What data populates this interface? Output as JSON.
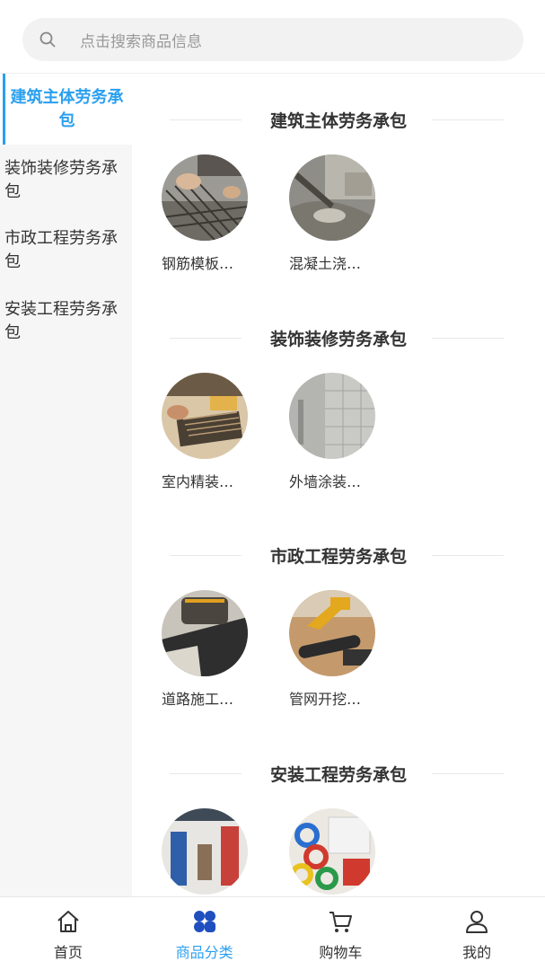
{
  "search": {
    "placeholder": "点击搜索商品信息",
    "icon": "search-icon"
  },
  "sidebar": {
    "items": [
      {
        "label": "建筑主体劳务承包",
        "active": true
      },
      {
        "label": "装饰装修劳务承包",
        "active": false
      },
      {
        "label": "市政工程劳务承包",
        "active": false
      },
      {
        "label": "安装工程劳务承包",
        "active": false
      }
    ]
  },
  "categories": [
    {
      "title": "建筑主体劳务承包",
      "items": [
        {
          "name": "钢筋模板…"
        },
        {
          "name": "混凝土浇…"
        }
      ]
    },
    {
      "title": "装饰装修劳务承包",
      "items": [
        {
          "name": "室内精装…"
        },
        {
          "name": "外墙涂装…"
        }
      ]
    },
    {
      "title": "市政工程劳务承包",
      "items": [
        {
          "name": "道路施工…"
        },
        {
          "name": "管网开挖…"
        }
      ]
    },
    {
      "title": "安装工程劳务承包",
      "items": [
        {
          "name": ""
        },
        {
          "name": ""
        }
      ]
    }
  ],
  "tabbar": {
    "tabs": [
      {
        "label": "首页",
        "icon": "home-icon",
        "active": false
      },
      {
        "label": "商品分类",
        "icon": "category-grid-icon",
        "active": true
      },
      {
        "label": "购物车",
        "icon": "cart-icon",
        "active": false
      },
      {
        "label": "我的",
        "icon": "user-icon",
        "active": false
      }
    ]
  },
  "colors": {
    "accent": "#2a9ff0",
    "sidebar_bg": "#f6f6f6",
    "accent_dark": "#1f4fbf"
  }
}
